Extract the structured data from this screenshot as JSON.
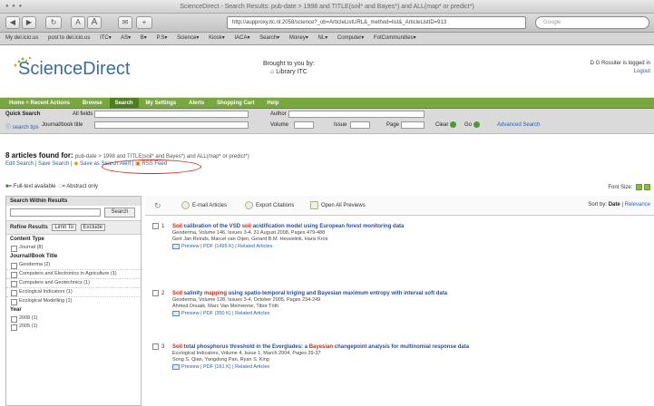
{
  "window": {
    "title": "ScienceDirect - Search Results: pub-date > 1998 and TITLE(soil* and Bayes*) and ALL(map* or predict*)"
  },
  "toolbar": {
    "back": "◀",
    "forward": "▶",
    "reload": "↻",
    "font_small": "A",
    "font_large": "A",
    "add": "+",
    "url": "http://aupproxy.itc.nl:2058/science?_ob=ArticleListURL&_method=list&_ArticleListID=913",
    "search_placeholder": "Google"
  },
  "bookmarks": [
    "My del.icio.us",
    "post to del.icio.us",
    "ITC▾",
    "AS▾",
    "B▾",
    "P.S▾",
    "Science▾",
    "Kiosk▾",
    "IACA▾",
    "Search▾",
    "Money▾",
    "NL▾",
    "Computer▾",
    "FotCommunities▾"
  ],
  "header": {
    "logo": "ScienceDirect",
    "brought_line1": "Brought to you by:",
    "brought_line2": "Library ITC",
    "user": "D G Rossiter is logged in",
    "logout": "Logout"
  },
  "nav": [
    "Home + Recent Actions",
    "Browse",
    "Search",
    "My Settings",
    "Alerts",
    "Shopping Cart",
    "Help"
  ],
  "quick_search": {
    "label": "Quick Search",
    "all_fields": "All fields",
    "author": "Author",
    "search_tips": "search tips",
    "journal_book": "Journal/book title",
    "volume": "Volume",
    "issue": "Issue",
    "page": "Page",
    "clear": "Clear",
    "go": "Go",
    "advanced": "Advanced Search"
  },
  "results": {
    "found": "8 articles found for:",
    "query": "pub-date > 1998 and TITLE(soil* and Bayes*) and ALL(map* or predict*)",
    "edit_search": "Edit Search",
    "save_search": "Save Search",
    "save_alert": "Save as Search Alert",
    "rss": "RSS Feed",
    "fulltext": "= Full-text available",
    "abstract_only": "= Abstract only",
    "font_size": "Font Size:"
  },
  "sidebar": {
    "within_label": "Search Within Results",
    "search_btn": "Search",
    "refine": "Refine Results",
    "limit_to": "Limit To",
    "exclude": "Exclude",
    "content_type": "Content Type",
    "content_items": [
      "Journal (8)"
    ],
    "journal_title": "Journal/Book Title",
    "journals": [
      "Geoderma (2)",
      "Computers and Electronics in Agriculture (1)",
      "Computers and Geotechnics (1)",
      "Ecological Indicators (1)",
      "Ecological Modelling (1)"
    ],
    "year": "Year",
    "years": [
      "2008 (1)",
      "2005 (1)"
    ]
  },
  "actions": {
    "email": "E-mail Articles",
    "export": "Export Citations",
    "open": "Open All Previews",
    "sort_by": "Sort by:",
    "date": "Date",
    "relevance": "Relevance"
  },
  "articles": [
    {
      "num": "1",
      "title_hl": "Soil",
      "title": " calibration of the VSD ",
      "title_hl2": "soil",
      "title_rest": " acidification model using European forest monitoring data",
      "journal": "Geoderma, Volume 146, Issues 3-4, 31 August 2008, Pages 479-488",
      "authors": "Gert Jan Reinds, Marcel van Oijen, Gerard B.M. Heuvelink, Hans Kros",
      "links": "Preview | PDF (1495 K) | Related Articles"
    },
    {
      "num": "2",
      "title_hl": "Soil",
      "title": " salinity ",
      "title_hl2": "mapping",
      "title_rest": " using spatio-temporal kriging and Bayesian maximum entropy with interval soft data",
      "journal": "Geoderma, Volume 128, Issues 3-4, October 2005, Pages 234-249",
      "authors": "Ahmed Douaik, Marc Van Meirvenne, Tibor Tóth",
      "links": "Preview | PDF (350 K) | Related Articles"
    },
    {
      "num": "3",
      "title_hl": "Soil",
      "title": " total phosphorus threshold in the Everglades: a ",
      "title_hl2": "Bayesian",
      "title_rest": " changepoint analysis for multinomial response data",
      "journal": "Ecological Indicators, Volume 4, Issue 1, March 2004, Pages 29-37",
      "authors": "Song S. Qian, Yangdong Pan, Ryan S. King",
      "links": "Preview | PDF (161 K) | Related Articles"
    }
  ]
}
